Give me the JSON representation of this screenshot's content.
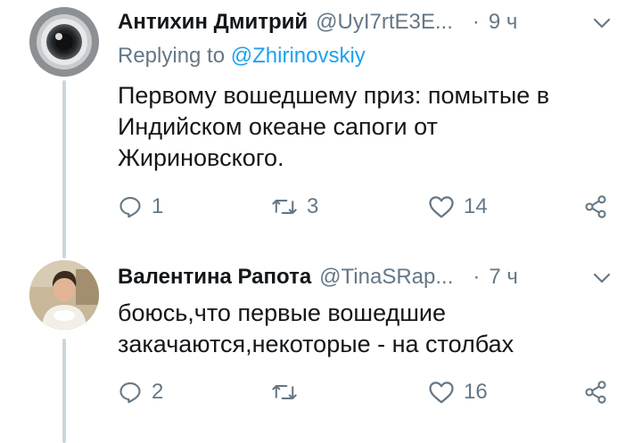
{
  "tweets": [
    {
      "name": "Антихин Дмитрий",
      "handle": "@UyI7rtE3E...",
      "dot": "·",
      "time": "9 ч",
      "replying_prefix": "Replying to ",
      "replying_handle": "@Zhirinovskiy",
      "text_lines": [
        "Первому вошедшему приз: помытые в",
        "Индийском океане сапоги от",
        "Жириновского."
      ],
      "replies": "1",
      "retweets": "3",
      "likes": "14",
      "avatar": "camera-lens-avatar"
    },
    {
      "name": "Валентина Рапота",
      "handle": "@TinaSRap...",
      "dot": "·",
      "time": "7 ч",
      "text_lines": [
        "боюсь,что первые вошедшие",
        "закачаются,некоторые - на столбах"
      ],
      "replies": "2",
      "retweets": "",
      "likes": "16",
      "avatar": "woman-photo-avatar"
    }
  ],
  "icons": [
    "reply-icon",
    "retweet-icon",
    "like-icon",
    "share-icon",
    "chevron-down-icon"
  ],
  "colors": {
    "text": "#14171a",
    "secondary": "#657786",
    "link": "#1da1f2",
    "thread": "#ccd6dd"
  }
}
